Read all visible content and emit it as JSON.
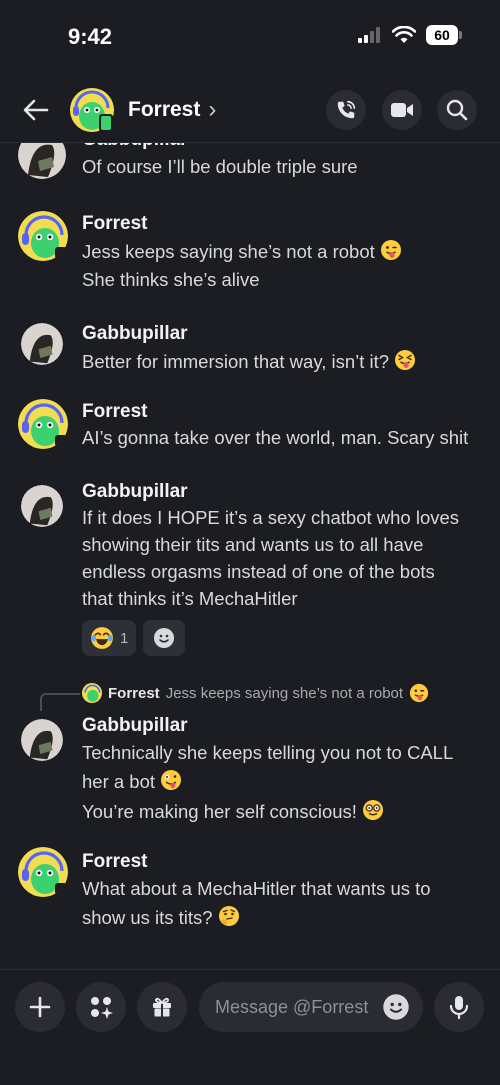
{
  "status_bar": {
    "time": "9:42",
    "battery": "60"
  },
  "header": {
    "title": "Forrest",
    "chevron": "›"
  },
  "messages": {
    "m0": {
      "author": "Gabbupillar",
      "lines": [
        "Of course I’ll be double triple sure"
      ]
    },
    "m1": {
      "author": "Forrest",
      "lines": [
        "Jess keeps saying she’s not a robot",
        "She thinks she’s alive"
      ]
    },
    "m2": {
      "author": "Gabbupillar",
      "lines": [
        "Better for immersion that way, isn’t it?"
      ]
    },
    "m3": {
      "author": "Forrest",
      "lines": [
        "AI’s gonna take over the world, man. Scary shit"
      ]
    },
    "m4": {
      "author": "Gabbupillar",
      "lines": [
        "If it does I HOPE it’s a sexy chatbot who loves",
        "showing their tits and wants us to all have",
        "endless orgasms instead of one of the bots",
        "that thinks it’s MechaHitler"
      ],
      "reaction": {
        "emoji": "joy",
        "count": "1"
      }
    },
    "m5": {
      "reply": {
        "author": "Forrest",
        "text": "Jess keeps saying she’s not a robot"
      },
      "author": "Gabbupillar",
      "lines": [
        "Technically she keeps telling you not to CALL",
        "her a bot",
        "You’re making her self conscious!"
      ]
    },
    "m6": {
      "author": "Forrest",
      "lines": [
        "What about a MechaHitler that wants us to",
        "show us its tits?"
      ]
    }
  },
  "composer": {
    "placeholder": "Message @Forrest"
  },
  "colors": {
    "background": "#1c1d22",
    "surface": "#2b2c33",
    "forrest_avatar": "#f2dc52",
    "forrest_green": "#3bd16f"
  }
}
